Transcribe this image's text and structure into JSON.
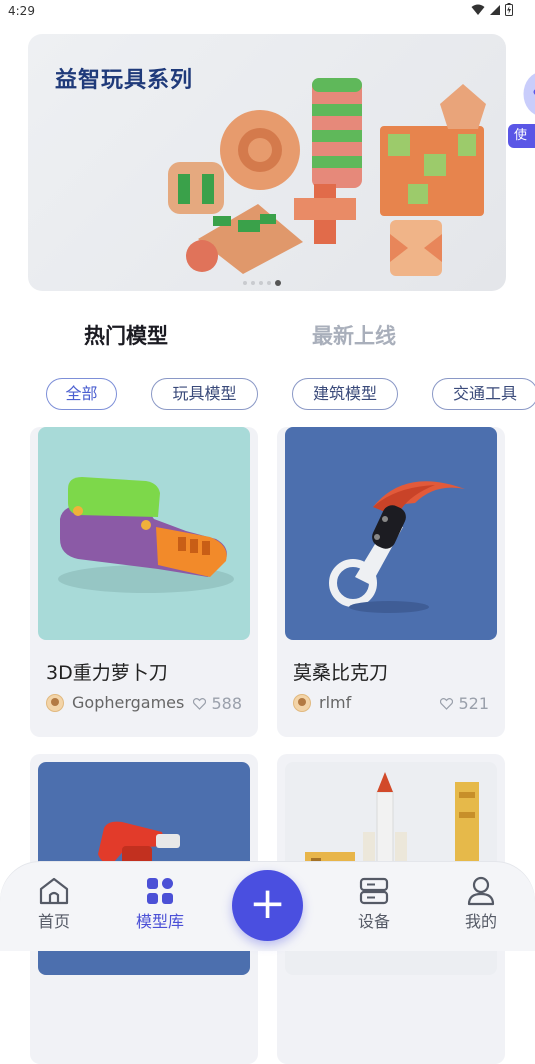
{
  "status_bar": {
    "time": "4:29"
  },
  "banner": {
    "title": "益智玩具系列",
    "slide_count": 5,
    "active_slide": 5,
    "peek_label": "使用"
  },
  "tabs": [
    {
      "label": "热门模型",
      "active": true
    },
    {
      "label": "最新上线",
      "active": false
    }
  ],
  "chips": [
    {
      "label": "全部",
      "active": true
    },
    {
      "label": "玩具模型",
      "active": false
    },
    {
      "label": "建筑模型",
      "active": false
    },
    {
      "label": "交通工具",
      "active": false
    }
  ],
  "cards": [
    {
      "title": "3D重力萝卜刀",
      "author": "Gophergames",
      "likes": "588",
      "image": "gravity-knife-image",
      "bg": "#a8dad8"
    },
    {
      "title": "莫桑比克刀",
      "author": "rlmf",
      "likes": "521",
      "image": "karambit-image",
      "bg": "#4c6fae"
    },
    {
      "title": "",
      "author": "",
      "likes": "",
      "image": "flare-gun-image",
      "bg": "#4c6fae"
    },
    {
      "title": "",
      "author": "",
      "likes": "",
      "image": "rocket-model-image",
      "bg": "#eceef2"
    }
  ],
  "tabbar": {
    "items": [
      {
        "label": "首页",
        "icon": "home-icon",
        "active": false
      },
      {
        "label": "模型库",
        "icon": "grid-icon",
        "active": true
      },
      {
        "label": "设备",
        "icon": "device-icon",
        "active": false
      },
      {
        "label": "我的",
        "icon": "user-icon",
        "active": false
      }
    ],
    "fab_icon": "plus-icon"
  },
  "colors": {
    "accent": "#4a4fe0",
    "banner_title": "#1f3a7a",
    "tab_inactive": "#a9afbb"
  }
}
